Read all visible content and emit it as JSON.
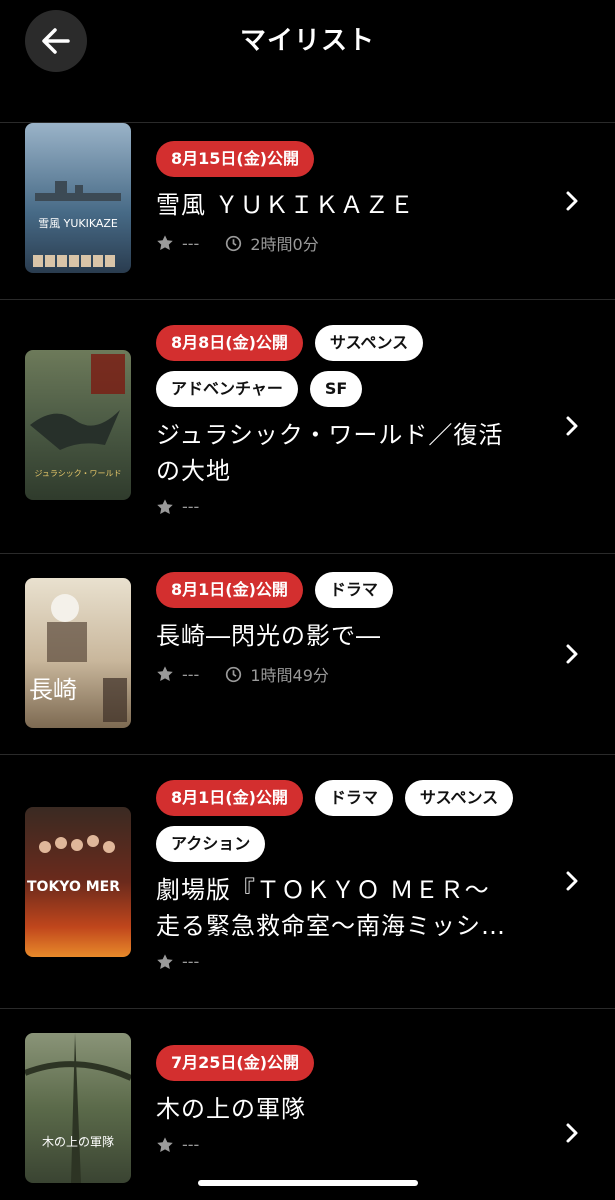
{
  "header": {
    "title": "マイリスト"
  },
  "movies": [
    {
      "release": "8月15日(金)公開",
      "genres": [],
      "title_lines": [
        "雪風 ＹＵＫＩＫＡＺＥ"
      ],
      "rating": "---",
      "duration": "2時間0分"
    },
    {
      "release": "8月8日(金)公開",
      "genres": [
        "サスペンス",
        "アドベンチャー",
        "SF"
      ],
      "title_lines": [
        "ジュラシック・ワールド／復活",
        "の大地"
      ],
      "rating": "---",
      "duration": ""
    },
    {
      "release": "8月1日(金)公開",
      "genres": [
        "ドラマ"
      ],
      "title_lines": [
        "長崎―閃光の影で―"
      ],
      "rating": "---",
      "duration": "1時間49分"
    },
    {
      "release": "8月1日(金)公開",
      "genres": [
        "ドラマ",
        "サスペンス",
        "アクション"
      ],
      "title_lines": [
        "劇場版『ＴＯＫＹＯ ＭＥＲ～",
        "走る緊急救命室～南海ミッシ…"
      ],
      "rating": "---",
      "duration": ""
    },
    {
      "release": "7月25日(金)公開",
      "genres": [],
      "title_lines": [
        "木の上の軍隊"
      ],
      "rating": "---",
      "duration": ""
    }
  ],
  "poster_texts": {
    "p1": "雪風 YUKIKAZE",
    "p2": "ジュラシック・ワールド",
    "p3": "長崎",
    "p4": "TOKYO MER",
    "p5": "木の上の軍隊"
  },
  "colors": {
    "accent": "#d32f2f",
    "background": "#000000"
  }
}
